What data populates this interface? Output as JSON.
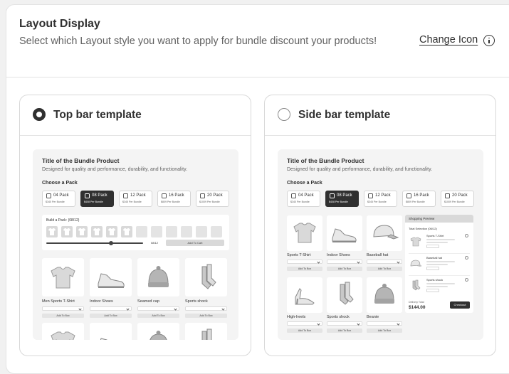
{
  "header": {
    "title": "Layout Display",
    "description": "Select which Layout style you want to apply for bundle discount your products!",
    "change_icon": "Change Icon",
    "info_icon": "info-icon"
  },
  "options": [
    {
      "label": "Top bar template",
      "selected": true
    },
    {
      "label": "Side bar template",
      "selected": false
    }
  ],
  "preview": {
    "title": "Title of the Bundle Product",
    "subtitle": "Designed for quality and performance, durability, and functionality.",
    "choose": "Choose a Pack",
    "packs": [
      {
        "label": "04 Pack",
        "price": "$340 Per Bundle"
      },
      {
        "label": "08 Pack",
        "price": "$408 Per Bundle",
        "selected": true
      },
      {
        "label": "12 Pack",
        "price": "$345 Per Bundle"
      },
      {
        "label": "16 Pack",
        "price": "$809 Per Bundle"
      },
      {
        "label": "20 Pack",
        "price": "$1009 Per Bundle"
      }
    ],
    "build_label": "Build a Pack: (08/12)",
    "build_count": "08/12",
    "build_progress": 0.67,
    "add_to_cart": "Add To Cart",
    "add_to_box": "Add To Box",
    "top_products": [
      "Men Sports T-Shirt",
      "Indoor Shoes",
      "Seamed cap",
      "Sports shock"
    ],
    "side_products": [
      "Sports T-Shirt",
      "Indoor Shoes",
      "Baseball hat",
      "High-heels",
      "Sports shock",
      "Beanie"
    ],
    "shopping": {
      "title": "Shopping Preview",
      "total_selection": "Total Selection (06/12)",
      "items": [
        "Sports T-Shirt",
        "Baseball hat",
        "Sports shock"
      ],
      "delivery_total": "Delivery Total",
      "amount": "$144.00",
      "checkout": "Checkout"
    }
  },
  "colors": {
    "primary": "#303030",
    "muted_text": "#616161",
    "border": "#e3e3e3",
    "preview_bg": "#f4f4f4",
    "placeholder": "#d9d9d9"
  }
}
